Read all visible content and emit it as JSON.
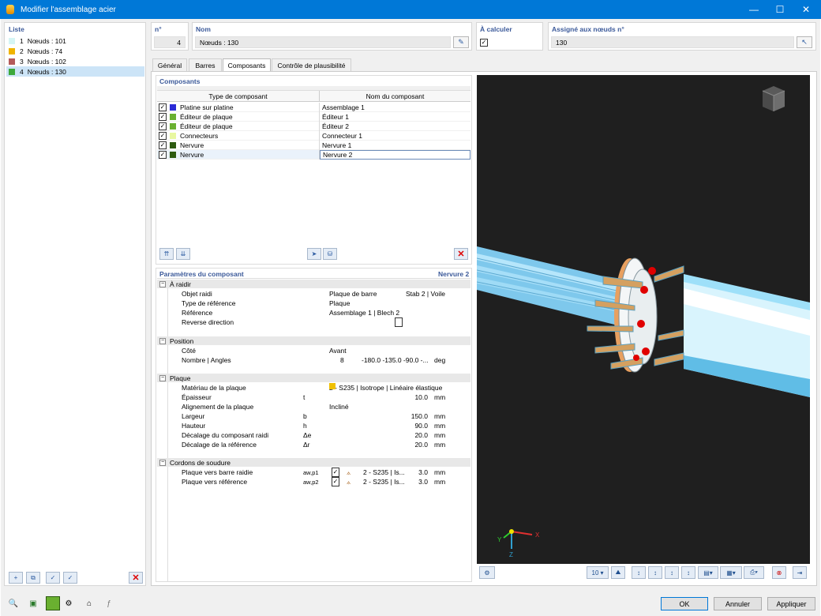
{
  "window": {
    "title": "Modifier l'assemblage acier",
    "min": "—",
    "max": "☐",
    "close": "✕"
  },
  "list": {
    "header": "Liste",
    "items": [
      {
        "num": "1",
        "label": "Nœuds : 101",
        "color": "#d5f5f5"
      },
      {
        "num": "2",
        "label": "Nœuds : 74",
        "color": "#f0b400"
      },
      {
        "num": "3",
        "label": "Nœuds : 102",
        "color": "#b45a5a"
      },
      {
        "num": "4",
        "label": "Nœuds : 130",
        "color": "#3ca83c"
      }
    ]
  },
  "header": {
    "no_label": "n°",
    "no_value": "4",
    "name_label": "Nom",
    "name_value": "Nœuds : 130",
    "calc_label": "À calculer",
    "calc_checked": "✓",
    "assigned_label": "Assigné aux nœuds n°",
    "assigned_value": "130"
  },
  "tabs": [
    "Général",
    "Barres",
    "Composants",
    "Contrôle de plausibilité"
  ],
  "components": {
    "header": "Composants",
    "col1": "Type de composant",
    "col2": "Nom du composant",
    "rows": [
      {
        "check": "✓",
        "color": "#2a2ad6",
        "type": "Platine sur platine",
        "name": "Assemblage 1"
      },
      {
        "check": "✓",
        "color": "#6ab030",
        "type": "Éditeur de plaque",
        "name": "Éditeur 1"
      },
      {
        "check": "✓",
        "color": "#6ab030",
        "type": "Éditeur de plaque",
        "name": "Éditeur 2"
      },
      {
        "check": "✓",
        "color": "#e8f7a0",
        "type": "Connecteurs",
        "name": "Connecteur 1"
      },
      {
        "check": "✓",
        "color": "#2d5a10",
        "type": "Nervure",
        "name": "Nervure 1"
      },
      {
        "check": "✓",
        "color": "#2d5a10",
        "type": "Nervure",
        "name": "Nervure 2"
      }
    ]
  },
  "params": {
    "header": "Paramètres du composant",
    "current": "Nervure 2",
    "sections": {
      "raidir": "À raidir",
      "position": "Position",
      "plaque": "Plaque",
      "soudure": "Cordons de soudure"
    },
    "raidir": {
      "objet_label": "Objet raidi",
      "objet_value": "Plaque de barre",
      "objet_value2": "Stab 2 | Voile",
      "typeref_label": "Type de référence",
      "typeref_value": "Plaque",
      "ref_label": "Référence",
      "ref_value": "Assemblage 1 | Blech 2",
      "reverse_label": "Reverse direction"
    },
    "position": {
      "cote_label": "Côté",
      "cote_value": "Avant",
      "nombre_label": "Nombre | Angles",
      "nombre_value": "8",
      "angles_value": "-180.0 -135.0 -90.0 -...",
      "angles_unit": "deg"
    },
    "plaque": {
      "mat_label": "Matériau de la plaque",
      "mat_value": "2 - S235 | Isotrope | Linéaire élastique",
      "mat_color": "#f0c000",
      "ep_label": "Épaisseur",
      "ep_sym": "t",
      "ep_value": "10.0",
      "ep_unit": "mm",
      "align_label": "Alignement de la plaque",
      "align_value": "Incliné",
      "larg_label": "Largeur",
      "larg_sym": "b",
      "larg_value": "150.0",
      "larg_unit": "mm",
      "haut_label": "Hauteur",
      "haut_sym": "h",
      "haut_value": "90.0",
      "haut_unit": "mm",
      "dece_label": "Décalage du composant raidi",
      "dece_sym": "Δe",
      "dece_value": "20.0",
      "dece_unit": "mm",
      "decr_label": "Décalage de la référence",
      "decr_sym": "Δr",
      "decr_value": "20.0",
      "decr_unit": "mm"
    },
    "soudure": {
      "w1_label": "Plaque vers barre raidie",
      "w1_sym": "aw,p1",
      "w1_mat": "2 - S235 | Is...",
      "w1_value": "3.0",
      "w1_unit": "mm",
      "w2_label": "Plaque vers référence",
      "w2_sym": "aw,p2",
      "w2_mat": "2 - S235 | Is...",
      "w2_value": "3.0",
      "w2_unit": "mm"
    }
  },
  "viewport": {
    "axis_x": "X",
    "axis_y": "Y",
    "axis_z": "Z",
    "zoom": "10"
  },
  "buttons": {
    "ok": "OK",
    "cancel": "Annuler",
    "apply": "Appliquer"
  }
}
